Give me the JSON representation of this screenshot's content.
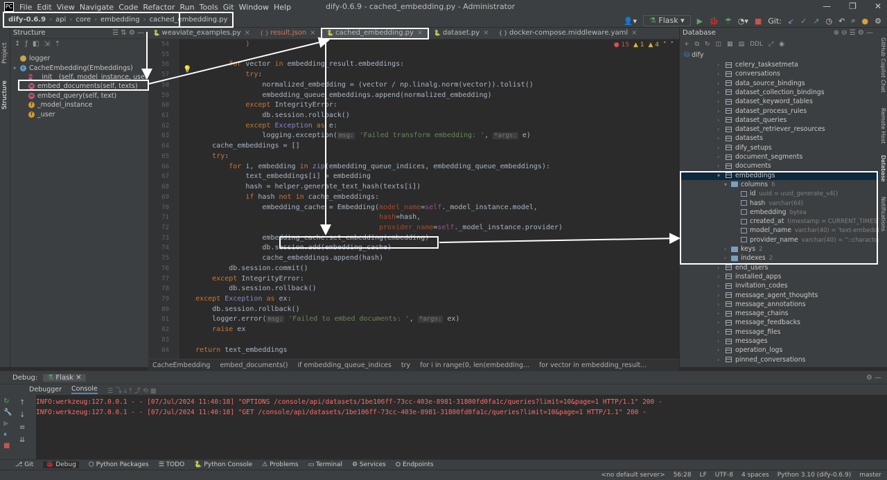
{
  "window": {
    "title": "dify-0.6.9 - cached_embedding.py - Administrator",
    "menu": [
      "File",
      "Edit",
      "View",
      "Navigate",
      "Code",
      "Refactor",
      "Run",
      "Tools",
      "Git",
      "Window",
      "Help"
    ]
  },
  "breadcrumb": [
    "dify-0.6.9",
    "api",
    "core",
    "embedding",
    "cached_embedding.py"
  ],
  "runbar": {
    "config": "Flask",
    "git_label": "Git:"
  },
  "left_strip": [
    "Project",
    "Structure"
  ],
  "structure": {
    "title": "Structure",
    "items": [
      {
        "label": "logger",
        "icon": "v",
        "indent": 0
      },
      {
        "label": "CacheEmbedding(Embeddings)",
        "icon": "c",
        "indent": 0
      },
      {
        "label": "__init__(self, model_instance, user=None)",
        "icon": "m",
        "indent": 1
      },
      {
        "label": "embed_documents(self, texts)",
        "icon": "m",
        "indent": 1
      },
      {
        "label": "embed_query(self, text)",
        "icon": "m",
        "indent": 1
      },
      {
        "label": "_model_instance",
        "icon": "f",
        "indent": 1
      },
      {
        "label": "_user",
        "icon": "f",
        "indent": 1
      }
    ]
  },
  "tabs": [
    {
      "label": "weaviate_examples.py",
      "active": false
    },
    {
      "label": "result.json",
      "active": false
    },
    {
      "label": "cached_embedding.py",
      "active": true
    },
    {
      "label": "dataset.py",
      "active": false
    },
    {
      "label": "docker-compose.middleware.yaml",
      "active": false
    }
  ],
  "inspections": {
    "errors": "15",
    "warnings": "1",
    "weak": "4"
  },
  "code": [
    {
      "n": "54",
      "html": "                <span class=\"kw\">)</span>"
    },
    {
      "n": "55",
      "html": ""
    },
    {
      "n": "56",
      "html": "            <span class=\"kw\">for</span> vector <span class=\"kw\">in</span> embedding_result.embeddings:"
    },
    {
      "n": "57",
      "html": "                <span class=\"kw\">try</span>:"
    },
    {
      "n": "58",
      "html": "                    normalized_embedding = (vector / np.linalg.norm(vector)).tolist()"
    },
    {
      "n": "59",
      "html": "                    embedding_queue_embeddings.append(normalized_embedding)"
    },
    {
      "n": "60",
      "html": "                <span class=\"kw\">except</span> IntegrityError:"
    },
    {
      "n": "61",
      "html": "                    db.session.rollback()"
    },
    {
      "n": "62",
      "html": "                <span class=\"kw\">except</span> <span class=\"bi\">Exception</span> <span class=\"kw\">as</span> e:"
    },
    {
      "n": "63",
      "html": "                    logging.exception(<span class=\"hint\">msg:</span> <span class=\"st\">'Failed transform embedding: '</span>, <span class=\"hint\">*args:</span> e)"
    },
    {
      "n": "64",
      "html": "        cache_embeddings = []"
    },
    {
      "n": "65",
      "html": "        <span class=\"kw\">try</span>:"
    },
    {
      "n": "66",
      "html": "            <span class=\"kw\">for</span> i, embedding <span class=\"kw\">in</span> <span class=\"bi\">zip</span>(embedding_queue_indices, embedding_queue_embeddings):"
    },
    {
      "n": "67",
      "html": "                text_embeddings[i] = embedding"
    },
    {
      "n": "68",
      "html": "                hash = helper.generate_text_hash(texts[i])"
    },
    {
      "n": "69",
      "html": "                <span class=\"kw\">if</span> hash <span class=\"kw\">not in</span> cache_embeddings:"
    },
    {
      "n": "70",
      "html": "                    embedding_cache = Embedding(<span class=\"pm\">model_name</span>=<span class=\"sf\">self</span>._model_instance.model,"
    },
    {
      "n": "71",
      "html": "                                                <span class=\"pm\">hash</span>=hash,"
    },
    {
      "n": "72",
      "html": "                                                <span class=\"pm\">provider_name</span>=<span class=\"sf\">self</span>._model_instance.provider)"
    },
    {
      "n": "73",
      "html": "                    embedding_cache.set_embedding(embedding)"
    },
    {
      "n": "74",
      "html": "                    db.session.add(embedding_cache)"
    },
    {
      "n": "75",
      "html": "                    cache_embeddings.append(hash)"
    },
    {
      "n": "76",
      "html": "            db.session.commit()"
    },
    {
      "n": "77",
      "html": "        <span class=\"kw\">except</span> IntegrityError:"
    },
    {
      "n": "78",
      "html": "            db.session.rollback()"
    },
    {
      "n": "79",
      "html": "    <span class=\"kw\">except</span> <span class=\"bi\">Exception</span> <span class=\"kw\">as</span> ex:"
    },
    {
      "n": "80",
      "html": "        db.session.rollback()"
    },
    {
      "n": "81",
      "html": "        logger.error(<span class=\"hint\">msg:</span> <span class=\"st\">'Failed to embed documents: '</span>, <span class=\"hint\">*args:</span> ex)"
    },
    {
      "n": "82",
      "html": "        <span class=\"kw\">raise</span> ex"
    },
    {
      "n": "83",
      "html": ""
    },
    {
      "n": "84",
      "html": "    <span class=\"kw\">return</span> text_embeddings"
    }
  ],
  "code_crumbs": [
    "CacheEmbedding",
    "embed_documents()",
    "if embedding_queue_indices",
    "try",
    "for i in range(0, len(embedding...",
    "for vector in embedding_result..."
  ],
  "right_strip": [
    "GitHub Copilot Chat",
    "Remote Host",
    "Database",
    "Notifications"
  ],
  "database": {
    "title": "Database",
    "datasource": "dify",
    "ddl": "DDL",
    "rows": [
      {
        "label": "celery_tasksetmeta",
        "kind": "table"
      },
      {
        "label": "conversations",
        "kind": "table"
      },
      {
        "label": "data_source_bindings",
        "kind": "table"
      },
      {
        "label": "dataset_collection_bindings",
        "kind": "table"
      },
      {
        "label": "dataset_keyword_tables",
        "kind": "table"
      },
      {
        "label": "dataset_process_rules",
        "kind": "table"
      },
      {
        "label": "dataset_queries",
        "kind": "table"
      },
      {
        "label": "dataset_retriever_resources",
        "kind": "table"
      },
      {
        "label": "datasets",
        "kind": "table"
      },
      {
        "label": "dify_setups",
        "kind": "table"
      },
      {
        "label": "document_segments",
        "kind": "table"
      },
      {
        "label": "documents",
        "kind": "table"
      },
      {
        "label": "embeddings",
        "kind": "table-open",
        "selected": true
      },
      {
        "label": "columns",
        "kind": "folder",
        "count": "6"
      },
      {
        "label": "id",
        "kind": "col",
        "type": "uuid = uuid_generate_v4()"
      },
      {
        "label": "hash",
        "kind": "col",
        "type": "varchar(64)"
      },
      {
        "label": "embedding",
        "kind": "col",
        "type": "bytea"
      },
      {
        "label": "created_at",
        "kind": "col",
        "type": "timestamp = CURRENT_TIMESTAMP(0)"
      },
      {
        "label": "model_name",
        "kind": "col",
        "type": "varchar(40) = 'text-embedding-ad..."
      },
      {
        "label": "provider_name",
        "kind": "col",
        "type": "varchar(40) = ''::character vary..."
      },
      {
        "label": "keys",
        "kind": "folder",
        "count": "2"
      },
      {
        "label": "indexes",
        "kind": "folder",
        "count": "2"
      },
      {
        "label": "end_users",
        "kind": "table"
      },
      {
        "label": "installed_apps",
        "kind": "table"
      },
      {
        "label": "invitation_codes",
        "kind": "table"
      },
      {
        "label": "message_agent_thoughts",
        "kind": "table"
      },
      {
        "label": "message_annotations",
        "kind": "table"
      },
      {
        "label": "message_chains",
        "kind": "table"
      },
      {
        "label": "message_feedbacks",
        "kind": "table"
      },
      {
        "label": "message_files",
        "kind": "table"
      },
      {
        "label": "messages",
        "kind": "table"
      },
      {
        "label": "operation_logs",
        "kind": "table"
      },
      {
        "label": "pinned_conversations",
        "kind": "table"
      }
    ]
  },
  "debug": {
    "label": "Debug:",
    "config": "Flask",
    "tabs": [
      "Debugger",
      "Console"
    ],
    "lines": [
      "INFO:werkzeug:127.0.0.1 - - [07/Jul/2024 11:40:18] \"OPTIONS /console/api/datasets/1be106ff-73cc-403e-8981-31800fd0fa1c/queries?limit=10&page=1 HTTP/1.1\" 200 -",
      "INFO:werkzeug:127.0.0.1 - - [07/Jul/2024 11:40:18] \"GET /console/api/datasets/1be106ff-73cc-403e-8981-31800fd0fa1c/queries?limit=10&page=1 HTTP/1.1\" 200 -"
    ]
  },
  "bottom_tools": [
    "Git",
    "Debug",
    "Python Packages",
    "TODO",
    "Python Console",
    "Problems",
    "Terminal",
    "Services",
    "Endpoints"
  ],
  "status": [
    "<no default server>",
    "56:28",
    "LF",
    "UTF-8",
    "4 spaces",
    "Python 3.10 (dify-0.6.9)",
    "master"
  ]
}
